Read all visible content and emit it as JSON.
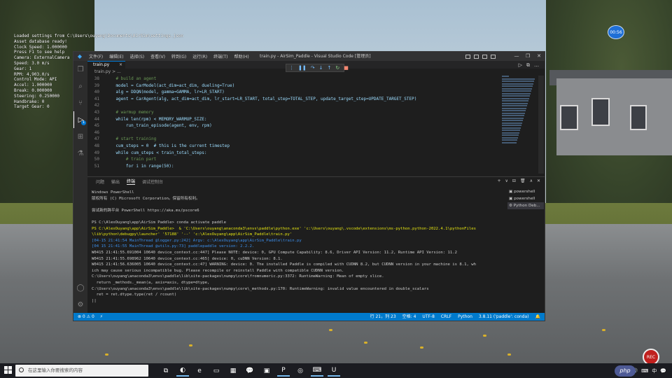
{
  "overlay": {
    "lines": [
      "Loaded settings from C:\\Users\\ouyang\\Documents\\AirSim\\settings.json",
      "Asset database ready!",
      "Clock Speed: 1.000000",
      "Press F1 to see help",
      "Camera: ExternalCamera",
      "Speed: 3.0 m/s",
      "Gear: 1",
      "RPM: 4,903.0/s",
      "Control Mode: API",
      "Accel: 1.000000",
      "Break: 0.000000",
      "Steering: 0.250000",
      "Handbrake: 0",
      "Target Gear: 0"
    ],
    "rec_top": "00:56",
    "rec_bottom": "REC"
  },
  "window": {
    "menu": [
      "文件(F)",
      "编辑(E)",
      "选择(S)",
      "查看(V)",
      "转到(G)",
      "运行(R)",
      "终端(T)",
      "帮助(H)"
    ],
    "title": "train.py - AirSim_Paddle - Visual Studio Code [管理员]",
    "controls": [
      "—",
      "❐",
      "✕"
    ]
  },
  "editor": {
    "tab_label": "train.py",
    "breadcrumb": "train.py > ...",
    "lines": [
      {
        "n": "38",
        "text": "    # build an agent",
        "type": "comment"
      },
      {
        "n": "39",
        "text": "    model = CarModel(act_dim=act_dim, dueling=True)",
        "type": "code"
      },
      {
        "n": "40",
        "text": "    alg = DDQN(model, gamma=GAMMA, lr=LR_START)",
        "type": "code"
      },
      {
        "n": "41",
        "text": "    agent = CarAgent(alg, act_dim=act_dim, lr_start=LR_START, total_step=TOTAL_STEP, update_target_step=UPDATE_TARGET_STEP)",
        "type": "code"
      },
      {
        "n": "42",
        "text": "",
        "type": "code"
      },
      {
        "n": "43",
        "text": "    # warmup memory",
        "type": "comment"
      },
      {
        "n": "44",
        "text": "    while len(rpm) < MEMORY_WARMUP_SIZE:",
        "type": "code"
      },
      {
        "n": "45",
        "text": "        run_train_episode(agent, env, rpm)",
        "type": "code"
      },
      {
        "n": "46",
        "text": "",
        "type": "code"
      },
      {
        "n": "47",
        "text": "    # start training",
        "type": "comment"
      },
      {
        "n": "48",
        "text": "    cum_steps = 0  # this is the current timestep",
        "type": "code"
      },
      {
        "n": "49",
        "text": "    while cum_steps < train_total_steps:",
        "type": "code"
      },
      {
        "n": "50",
        "text": "        # train part",
        "type": "comment"
      },
      {
        "n": "51",
        "text": "        for i in range(50):",
        "type": "code"
      }
    ]
  },
  "panel": {
    "tabs": [
      "问题",
      "输出",
      "终端",
      "调试控制台"
    ],
    "active_tab": 2,
    "actions": [
      "+",
      "∨",
      "⊟",
      "🗑",
      "∧",
      "✕"
    ],
    "terminals": [
      "powershell",
      "powershell",
      "Python Deb..."
    ],
    "terminal_lines": [
      {
        "text": "Windows PowerShell",
        "style": "dim"
      },
      {
        "text": "版权所有 (C) Microsoft Corporation。保留所有权利。",
        "style": "dim"
      },
      {
        "text": "",
        "style": "dim"
      },
      {
        "text": "尝试新的跨平台 PowerShell https://aka.ms/pscore6",
        "style": "dim"
      },
      {
        "text": "",
        "style": "dim"
      },
      {
        "text": "PS C:\\AlexOuyang\\app\\AirSim Paddle> conda activate paddle",
        "style": "dim"
      },
      {
        "text": "PS C:\\AlexOuyang\\app\\AirSim_Paddle>  & 'C:\\Users\\ouyang\\anaconda3\\envs\\paddle\\python.exe' 'c:\\Users\\ouyang\\.vscode\\extensions\\ms-python.python-2022.4.1\\pythonFiles",
        "style": "yellow"
      },
      {
        "text": "\\lib\\python\\debugpy\\launcher' '57188' '--' 'c:\\AlexOuyang\\app\\AirSim_Paddle\\train.py'",
        "style": "yellow"
      },
      {
        "text": "[04-15 21:41:54 MainThread @logger.py:242] Argv: c:\\AlexOuyang\\app\\AirSim_Paddle\\train.py",
        "style": "blue"
      },
      {
        "text": "[04 15 21:41:55 MainThread @utils.py:73] paddlepaddle version: 2.2.2.",
        "style": "blue"
      },
      {
        "text": "W0415 21:41:55.691004 10640 device_context.cc:447] Please NOTE: device: 0, GPU Compute Capability: 8.6, Driver API Version: 11.2, Runtime API Version: 11.2",
        "style": "dim"
      },
      {
        "text": "W0415 21:41:55.698962 10640 device_context.cc:465] device: 0, cuDNN Version: 8.1.",
        "style": "dim"
      },
      {
        "text": "W0415 21:41:56.636005 10640 device_context.cc:47] WARNING: device: 0. The installed Paddle is compiled with CUDNN 8.2, but CUDNN version in your machine is 8.1, wh",
        "style": "dim"
      },
      {
        "text": "ich may cause serious incompatible bug. Please recompile or reinstall Paddle with compatible CUDNN version.",
        "style": "dim"
      },
      {
        "text": "C:\\Users\\ouyang\\anaconda3\\envs\\paddle\\lib\\site-packages\\numpy\\core\\fromnumeric.py:3372: RuntimeWarning: Mean of empty slice.",
        "style": "dim"
      },
      {
        "text": "  return _methods._mean(a, axis=axis, dtype=dtype,",
        "style": "dim"
      },
      {
        "text": "C:\\Users\\ouyang\\anaconda3\\envs\\paddle\\lib\\site-packages\\numpy\\core\\_methods.py:170: RuntimeWarning: invalid value encountered in double_scalars",
        "style": "dim"
      },
      {
        "text": "  ret = ret.dtype.type(ret / rcount)",
        "style": "dim"
      },
      {
        "text": "||",
        "style": "dim"
      }
    ]
  },
  "statusbar": {
    "left": [
      "⊗ 0 ⚠ 0",
      "⚡"
    ],
    "right": [
      "行 21，列 23",
      "空格: 4",
      "UTF-8",
      "CRLF",
      "Python",
      "3.8.11 ('paddle': conda)",
      "🔔"
    ]
  },
  "taskbar": {
    "search_placeholder": "在这里输入你要搜索的内容",
    "apps": [
      "⧉",
      "◐",
      "e",
      "▭",
      "▦",
      "💬",
      "▣",
      "P",
      "◎",
      "⌨",
      "U"
    ],
    "tray": [
      "^",
      "🔊",
      "⌨",
      "中",
      "💬"
    ],
    "badge": "php"
  },
  "colors": {
    "accent": "#007acc",
    "editor_bg": "#1e1e1e",
    "rec_red": "#c0201e"
  }
}
